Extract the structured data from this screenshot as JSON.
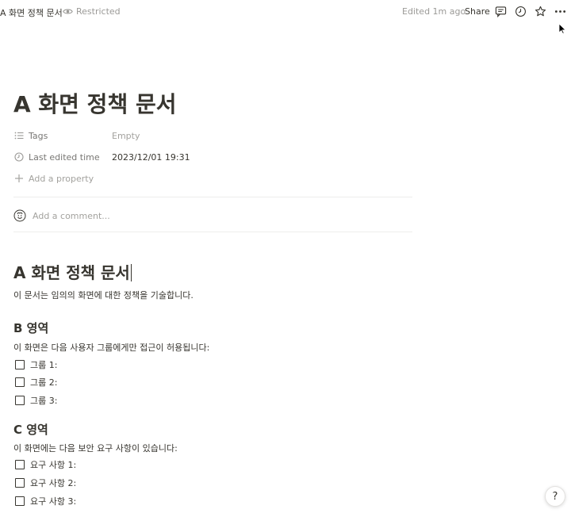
{
  "topbar": {
    "breadcrumb": "A 화면 정책 문서",
    "restricted": "Restricted",
    "edited": "Edited 1m ago",
    "share": "Share"
  },
  "page": {
    "title": "A 화면 정책 문서",
    "properties": {
      "tags_label": "Tags",
      "tags_value": "Empty",
      "edited_label": "Last edited time",
      "edited_value": "2023/12/01 19:31",
      "add_property": "Add a property"
    },
    "comment_placeholder": "Add a comment..."
  },
  "content": {
    "heading1": "A 화면 정책 문서",
    "intro": "이 문서는 임의의 화면에 대한 정책을 기술합니다.",
    "section_b": {
      "heading": "B 영역",
      "text": "이 화면은 다음 사용자 그룹에게만 접근이 허용됩니다:",
      "todos": [
        "그룹 1:",
        "그룹 2:",
        "그룹 3:"
      ]
    },
    "section_c": {
      "heading": "C 영역",
      "text": "이 화면에는 다음 보안 요구 사항이 있습니다:",
      "todos": [
        "요구 사항 1:",
        "요구 사항 2:",
        "요구 사항 3:"
      ]
    }
  },
  "help": {
    "label": "?"
  },
  "icons": {
    "eye": "eye-icon",
    "comment": "comment-icon",
    "clock": "clock-icon",
    "star": "star-icon",
    "more": "more-icon",
    "list": "list-icon",
    "plus": "plus-icon"
  }
}
